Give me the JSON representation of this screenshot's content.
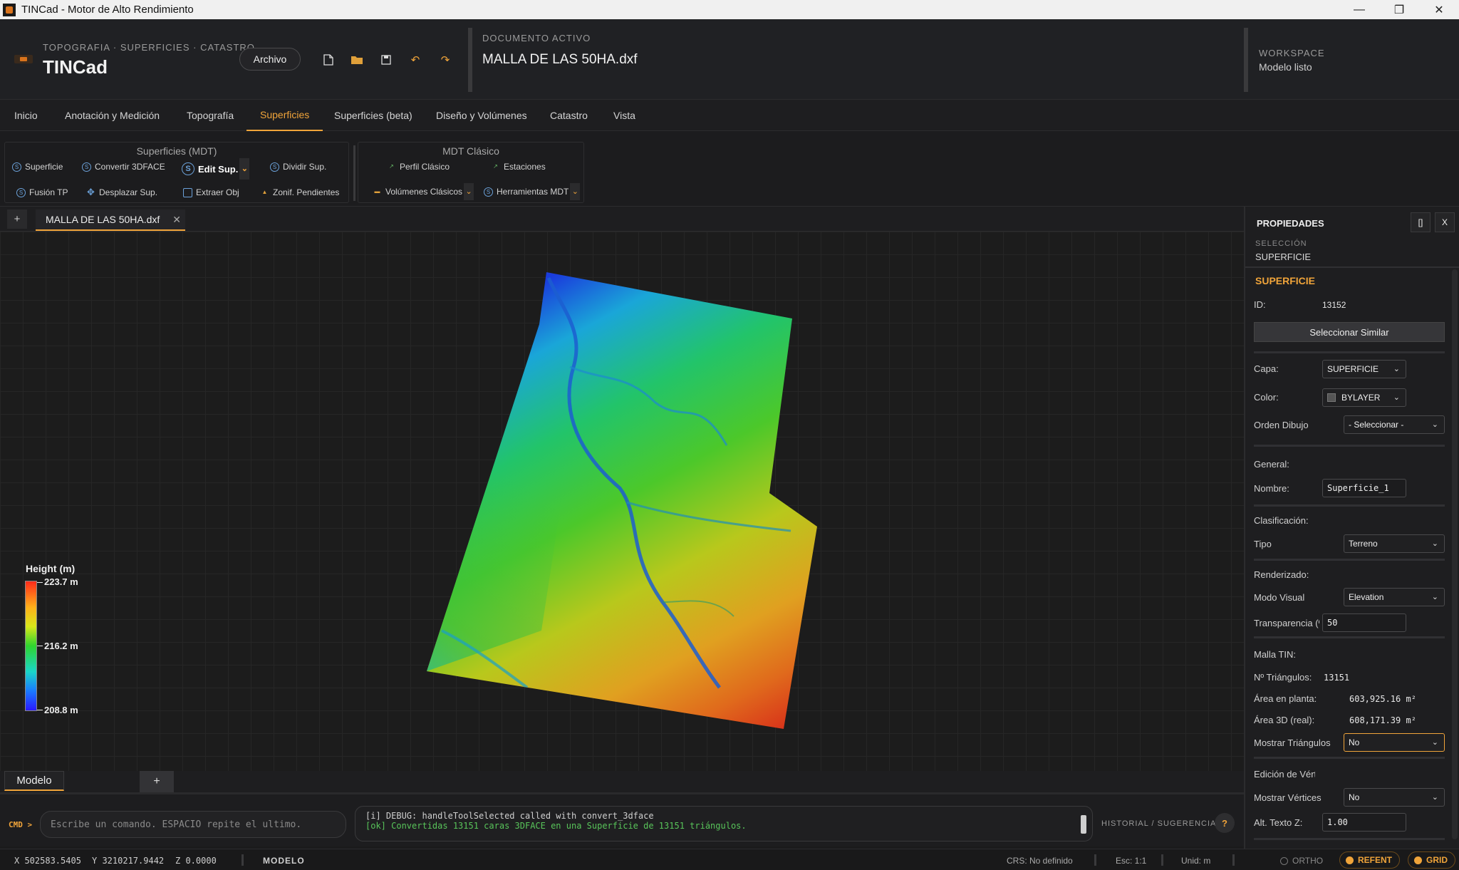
{
  "window": {
    "title": "TINCad - Motor de Alto Rendimiento",
    "controls": {
      "minimize": "—",
      "restore": "❐",
      "close": "✕"
    }
  },
  "header": {
    "breadcrumb": "TOPOGRAFIA · SUPERFICIES · CATASTRO",
    "app_name": "TINCad",
    "archivo_label": "Archivo",
    "quick_icons": [
      "new-file-icon",
      "open-folder-icon",
      "save-icon",
      "undo-icon",
      "redo-icon"
    ],
    "doc_label": "DOCUMENTO ACTIVO",
    "doc_name": "MALLA DE LAS 50HA.dxf",
    "workspace_label": "WORKSPACE",
    "workspace_status": "Modelo listo"
  },
  "tabs": [
    {
      "label": "Inicio"
    },
    {
      "label": "Anotación y Medición"
    },
    {
      "label": "Topografía"
    },
    {
      "label": "Superficies"
    },
    {
      "label": "Superficies (beta)"
    },
    {
      "label": "Diseño y Volúmenes"
    },
    {
      "label": "Catastro"
    },
    {
      "label": "Vista"
    }
  ],
  "active_tab": "Superficies",
  "ribbon": {
    "group1": {
      "title": "Superficies (MDT)",
      "superficie": "Superficie",
      "convertir": "Convertir 3DFACE",
      "edit": "Edit Sup.",
      "dividir": "Dividir Sup.",
      "fusion": "Fusión TP",
      "desplazar": "Desplazar Sup.",
      "extraer": "Extraer Obj",
      "zonif": "Zonif. Pendientes"
    },
    "group2": {
      "title": "MDT Clásico",
      "perfil": "Perfil Clásico",
      "estaciones": "Estaciones",
      "volumenes": "Volúmenes Clásicos",
      "herramientas": "Herramientas MDT"
    }
  },
  "doc_tabs": {
    "plus": "+",
    "active": "MALLA DE LAS 50HA.dxf",
    "close": "✕"
  },
  "legend": {
    "title": "Height (m)",
    "max": "223.7 m",
    "mid": "216.2 m",
    "min": "208.8 m"
  },
  "sheet_tabs": {
    "model": "Modelo",
    "plus": "+"
  },
  "command": {
    "label": "CMD >",
    "placeholder": "Escribe un comando. ESPACIO repite el ultimo.",
    "log": [
      "[i] DEBUG: handleToolSelected called with convert_3dface",
      "[ok] Convertidas 13151 caras 3DFACE en una Superficie de 13151 triángulos."
    ],
    "history_label": "HISTORIAL / SUGERENCIAS",
    "help": "?"
  },
  "status": {
    "x": "X 502583.5405",
    "y": "Y 3210217.9442",
    "z": "Z 0.0000",
    "mode": "MODELO",
    "crs": "CRS: No definido",
    "scale": "Esc: 1:1",
    "units": "Unid: m",
    "ortho": "ORTHO",
    "refent": "REFENT",
    "grid": "GRID"
  },
  "properties": {
    "title": "PROPIEDADES",
    "btn_dock": "[]",
    "btn_close": "X",
    "selection_label": "SELECCIÓN",
    "selection_value": "SUPERFICIE",
    "section": "SUPERFICIE",
    "id_label": "ID:",
    "id_value": "13152",
    "select_similar": "Seleccionar Similar",
    "capa_label": "Capa:",
    "capa_value": "SUPERFICIE",
    "color_label": "Color:",
    "color_value": "BYLAYER",
    "orden_label": "Orden Dibujo",
    "orden_value": "- Seleccionar -",
    "general_label": "General:",
    "nombre_label": "Nombre:",
    "nombre_value": "Superficie_1",
    "clasif_label": "Clasificación:",
    "tipo_label": "Tipo",
    "tipo_value": "Terreno",
    "render_label": "Renderizado:",
    "modo_label": "Modo Visual",
    "modo_value": "Elevation",
    "transp_label": "Transparencia (%)",
    "transp_value": "50",
    "malla_label": "Malla TIN:",
    "ntri_label": "Nº Triángulos:",
    "ntri_value": "13151",
    "area_planta_label": "Área en planta:",
    "area_planta_value": "603,925.16 m²",
    "area3d_label": "Área 3D (real):",
    "area3d_value": "608,171.39 m²",
    "mostrar_tri_label": "Mostrar Triángulos",
    "mostrar_tri_value": "No",
    "edicion_label": "Edición de Vértices",
    "mostrar_vert_label": "Mostrar Vértices",
    "mostrar_vert_value": "No",
    "alt_texto_label": "Alt. Texto Z:",
    "alt_texto_value": "1.00"
  },
  "colors": {
    "accent": "#f0a43a",
    "ok": "#58c45a",
    "background": "#1c1c1c"
  }
}
